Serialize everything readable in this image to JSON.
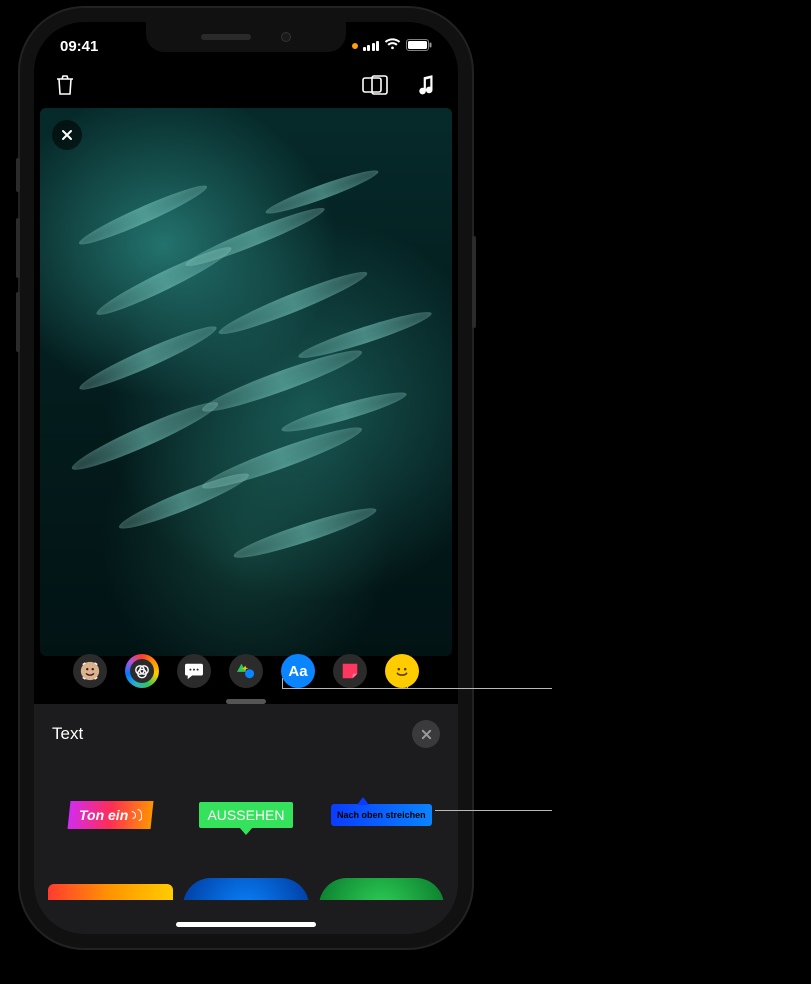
{
  "status": {
    "time": "09:41"
  },
  "sheet": {
    "title": "Text",
    "labels": [
      "Ton ein",
      "AUSSEHEN",
      "Nach oben streichen"
    ]
  },
  "toolbar": {
    "text_button_label": "Aa"
  }
}
